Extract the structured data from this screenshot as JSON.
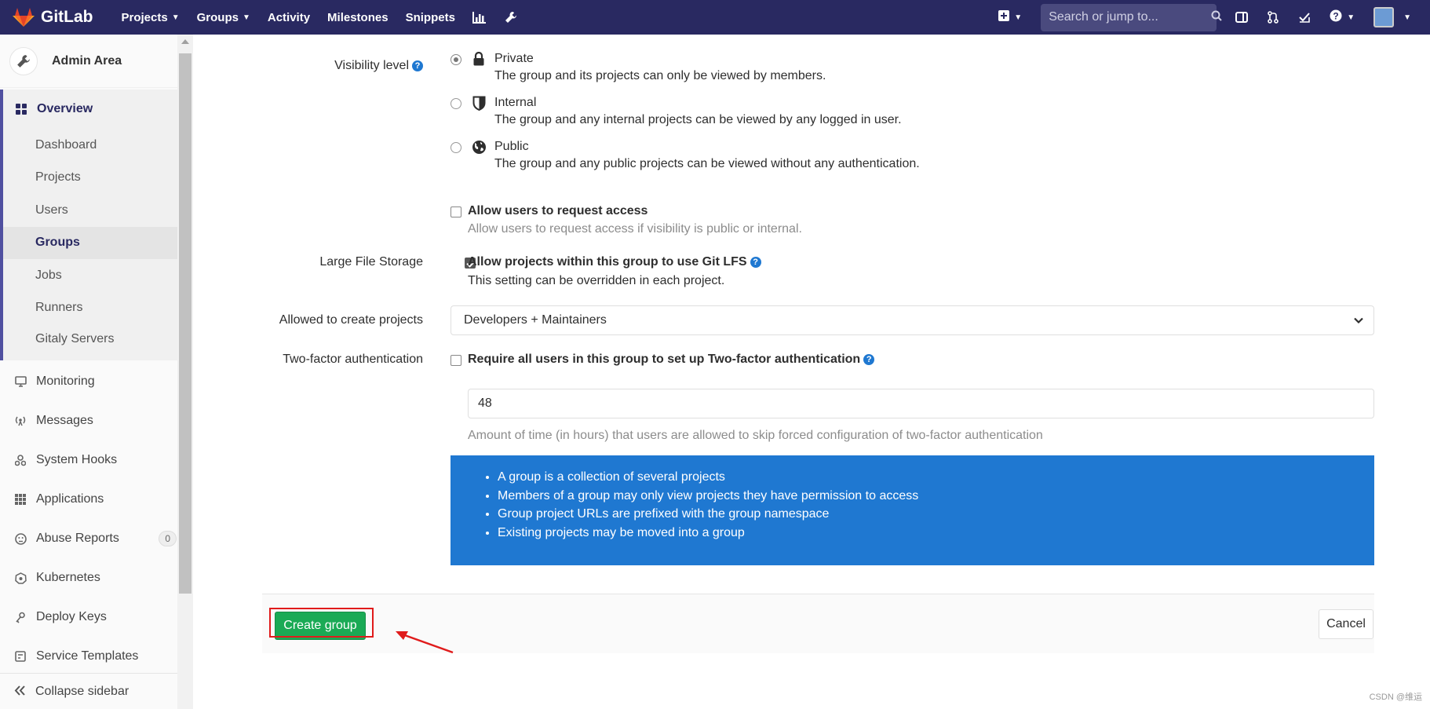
{
  "navbar": {
    "brand": "GitLab",
    "links": [
      {
        "label": "Projects",
        "dropdown": true
      },
      {
        "label": "Groups",
        "dropdown": true
      },
      {
        "label": "Activity",
        "dropdown": false
      },
      {
        "label": "Milestones",
        "dropdown": false
      },
      {
        "label": "Snippets",
        "dropdown": false
      }
    ],
    "search_placeholder": "Search or jump to...",
    "colors": {
      "background": "#292961",
      "search_bg": "#4a4a7e"
    }
  },
  "sidebar": {
    "title": "Admin Area",
    "overview_label": "Overview",
    "overview_items": [
      "Dashboard",
      "Projects",
      "Users",
      "Groups",
      "Jobs",
      "Runners",
      "Gitaly Servers"
    ],
    "active_item": "Groups",
    "items": [
      {
        "label": "Monitoring",
        "icon": "monitor-icon"
      },
      {
        "label": "Messages",
        "icon": "broadcast-icon"
      },
      {
        "label": "System Hooks",
        "icon": "hook-icon"
      },
      {
        "label": "Applications",
        "icon": "grid-icon"
      },
      {
        "label": "Abuse Reports",
        "icon": "face-icon",
        "badge": "0"
      },
      {
        "label": "Kubernetes",
        "icon": "kubernetes-icon"
      },
      {
        "label": "Deploy Keys",
        "icon": "key-icon"
      },
      {
        "label": "Service Templates",
        "icon": "template-icon"
      }
    ],
    "collapse_label": "Collapse sidebar"
  },
  "form": {
    "visibility": {
      "label": "Visibility level",
      "selected": "Private",
      "options": [
        {
          "title": "Private",
          "desc": "The group and its projects can only be viewed by members.",
          "icon": "lock-icon"
        },
        {
          "title": "Internal",
          "desc": "The group and any internal projects can be viewed by any logged in user.",
          "icon": "shield-icon"
        },
        {
          "title": "Public",
          "desc": "The group and any public projects can be viewed without any authentication.",
          "icon": "globe-icon"
        }
      ]
    },
    "request_access": {
      "checked": false,
      "title": "Allow users to request access",
      "desc": "Allow users to request access if visibility is public or internal."
    },
    "lfs": {
      "label": "Large File Storage",
      "checked": true,
      "title": "Allow projects within this group to use Git LFS",
      "desc": "This setting can be overridden in each project."
    },
    "create_projects": {
      "label": "Allowed to create projects",
      "value": "Developers + Maintainers"
    },
    "two_factor": {
      "label": "Two-factor authentication",
      "checked": false,
      "title": "Require all users in this group to set up Two-factor authentication",
      "grace_value": "48",
      "grace_help": "Amount of time (in hours) that users are allowed to skip forced configuration of two-factor authentication"
    },
    "info_items": [
      "A group is a collection of several projects",
      "Members of a group may only view projects they have permission to access",
      "Group project URLs are prefixed with the group namespace",
      "Existing projects may be moved into a group"
    ],
    "create_button": "Create group",
    "cancel_button": "Cancel"
  },
  "watermark": "CSDN @维运",
  "colors": {
    "accent": "#1f78d1",
    "create_button": "#1aaa55",
    "highlight": "#e01b1b"
  }
}
